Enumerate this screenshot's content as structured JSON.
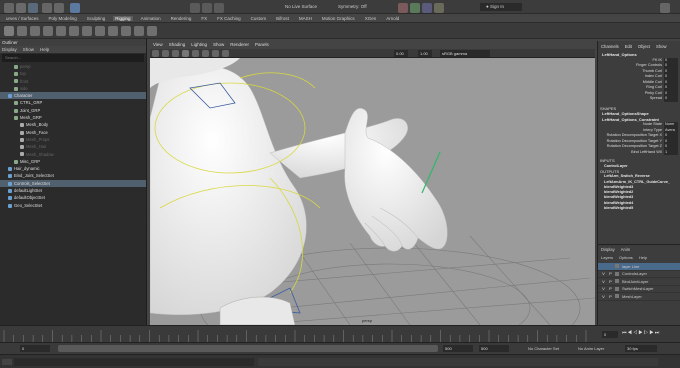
{
  "top": {
    "surface_mode": "No Live Surface",
    "symmetry": "Symmetry: Off",
    "sign_in": "Sign In"
  },
  "shelf_tabs": [
    "urves / Surfaces",
    "Poly Modeling",
    "Sculpting",
    "Rigging",
    "Animation",
    "Rendering",
    "FX",
    "FX Caching",
    "Custom",
    "Bifrost",
    "MASH",
    "Motion Graphics",
    "XGen",
    "Arnold"
  ],
  "shelf_active": "Rigging",
  "outliner": {
    "title": "Outliner",
    "menu": [
      "Display",
      "Show",
      "Help"
    ],
    "search_placeholder": "Search...",
    "rows": [
      {
        "label": "persp",
        "indent": 2,
        "state": "dim"
      },
      {
        "label": "top",
        "indent": 2,
        "state": "dim"
      },
      {
        "label": "front",
        "indent": 2,
        "state": "dim"
      },
      {
        "label": "side",
        "indent": 2,
        "state": "dim"
      },
      {
        "label": "Character",
        "indent": 1,
        "state": "sel"
      },
      {
        "label": "CTRL_GRP",
        "indent": 2,
        "state": "normal"
      },
      {
        "label": "Joint_GRP",
        "indent": 2,
        "state": "normal"
      },
      {
        "label": "Mesh_GRP",
        "indent": 2,
        "state": "normal"
      },
      {
        "label": "Mesh_Body",
        "indent": 3,
        "state": "normal"
      },
      {
        "label": "Mesh_Face",
        "indent": 3,
        "state": "normal"
      },
      {
        "label": "Mesh_Props",
        "indent": 3,
        "state": "dim"
      },
      {
        "label": "Mesh_Hair",
        "indent": 3,
        "state": "dim"
      },
      {
        "label": "Mesh_Shadow",
        "indent": 3,
        "state": "dim"
      },
      {
        "label": "Misc_GRP",
        "indent": 2,
        "state": "normal"
      },
      {
        "label": "Hair_dynamic",
        "indent": 1,
        "state": "normal"
      },
      {
        "label": "Bind_Joint_SelectSet",
        "indent": 1,
        "state": "normal"
      },
      {
        "label": "Controls_SelectSet",
        "indent": 1,
        "state": "sel"
      },
      {
        "label": "defaultLightSet",
        "indent": 1,
        "state": "normal"
      },
      {
        "label": "defaultObjectSet",
        "indent": 1,
        "state": "normal"
      },
      {
        "label": "Geo_SelectSet",
        "indent": 1,
        "state": "normal"
      }
    ]
  },
  "viewport": {
    "menu": [
      "View",
      "Shading",
      "Lighting",
      "Show",
      "Renderer",
      "Panels"
    ],
    "field_a": "0.00",
    "field_b": "1.00",
    "colorspace": "sRGB gamma",
    "camera_label": "persp"
  },
  "channelbox": {
    "menu": [
      "Channels",
      "Edit",
      "Object",
      "Show"
    ],
    "object_name": "LeftHand_Options",
    "attributes": [
      {
        "label": "FK IK",
        "value": "0"
      },
      {
        "label": "Finger Controls",
        "value": "0"
      },
      {
        "label": "Thumb Curl",
        "value": "0"
      },
      {
        "label": "Index Curl",
        "value": "0"
      },
      {
        "label": "Middle Curl",
        "value": "0"
      },
      {
        "label": "Ring Curl",
        "value": "0"
      },
      {
        "label": "Pinky Curl",
        "value": "0"
      },
      {
        "label": "Spread",
        "value": "0"
      }
    ],
    "shapes_header": "SHAPES",
    "shape_names": [
      "LeftHand_OptionsShape",
      "LeftHand_Options_Constraint"
    ],
    "shape_attrs": [
      {
        "label": "Node State",
        "value": "Norm"
      },
      {
        "label": "Interp Type",
        "value": "Avera"
      },
      {
        "label": "Rotation Decomposition Target X",
        "value": "0"
      },
      {
        "label": "Rotation Decomposition Target Y",
        "value": "0"
      },
      {
        "label": "Rotation Decomposition Target Z",
        "value": "0"
      },
      {
        "label": "Bind LeftHand W0",
        "value": "1"
      }
    ],
    "inputs_header": "INPUTS",
    "inputs": [
      "ControlLayer"
    ],
    "outputs_header": "OUTPUTS",
    "outputs": [
      "LeftArm_Switch_Reverse",
      "LeftArmArm_IK_CTRL_GuideCurve_",
      "blendWeighted3",
      "blendWeighted2",
      "blendWeighted3",
      "blendWeighted4",
      "blendWeighted5"
    ]
  },
  "layers": {
    "tabs": [
      "Display",
      "Anim"
    ],
    "menu": [
      "Layers",
      "Options",
      "Help"
    ],
    "rows": [
      {
        "v": "",
        "p": "",
        "label": "layer Line",
        "sel": true
      },
      {
        "v": "V",
        "p": "P",
        "label": "ControlsLayer",
        "sel": false
      },
      {
        "v": "V",
        "p": "P",
        "label": "BindJointLayer",
        "sel": false
      },
      {
        "v": "V",
        "p": "P",
        "label": "SwitchMeshLayer",
        "sel": false
      },
      {
        "v": "V",
        "p": "P",
        "label": "MeshLayer",
        "sel": false
      }
    ]
  },
  "timeline": {
    "current_frame": "0",
    "range_start": "0",
    "range_end": "500",
    "range_end2": "500",
    "character_set": "No Character Set",
    "anim_layer": "No Anim Layer",
    "fps": "30 fps"
  },
  "colors": {
    "accent_blue": "#4a6a8c",
    "selection": "#51606f",
    "bg_dark": "#2b2b2b",
    "viewport_bg": "#9b9b9b"
  }
}
